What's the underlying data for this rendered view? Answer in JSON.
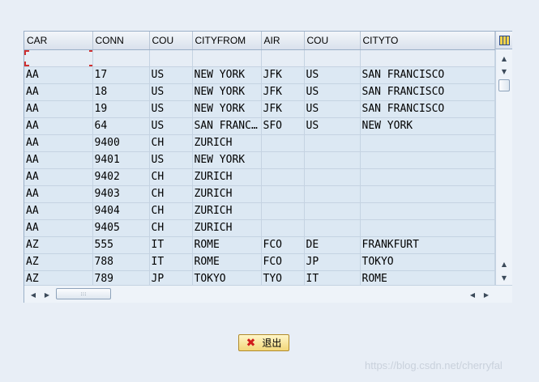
{
  "grid": {
    "columns": [
      "CAR",
      "CONN",
      "COU",
      "CITYFROM",
      "AIR",
      "COU",
      "CITYTO"
    ],
    "rows": [
      [
        "AA",
        "17",
        "US",
        "NEW YORK",
        "JFK",
        "US",
        "SAN FRANCISCO"
      ],
      [
        "AA",
        "18",
        "US",
        "NEW YORK",
        "JFK",
        "US",
        "SAN FRANCISCO"
      ],
      [
        "AA",
        "19",
        "US",
        "NEW YORK",
        "JFK",
        "US",
        "SAN FRANCISCO"
      ],
      [
        "AA",
        "64",
        "US",
        "SAN FRANC…",
        "SFO",
        "US",
        "NEW YORK"
      ],
      [
        "AA",
        "9400",
        "CH",
        "ZURICH",
        "",
        "",
        ""
      ],
      [
        "AA",
        "9401",
        "US",
        "NEW YORK",
        "",
        "",
        ""
      ],
      [
        "AA",
        "9402",
        "CH",
        "ZURICH",
        "",
        "",
        ""
      ],
      [
        "AA",
        "9403",
        "CH",
        "ZURICH",
        "",
        "",
        ""
      ],
      [
        "AA",
        "9404",
        "CH",
        "ZURICH",
        "",
        "",
        ""
      ],
      [
        "AA",
        "9405",
        "CH",
        "ZURICH",
        "",
        "",
        ""
      ],
      [
        "AZ",
        "555",
        "IT",
        "ROME",
        "FCO",
        "DE",
        "FRANKFURT"
      ],
      [
        "AZ",
        "788",
        "IT",
        "ROME",
        "FCO",
        "JP",
        "TOKYO"
      ],
      [
        "AZ",
        "789",
        "JP",
        "TOKYO",
        "TYO",
        "IT",
        "ROME"
      ]
    ]
  },
  "icons": {
    "layout": "layout-icon",
    "scroll_up": "▲",
    "scroll_down": "▼",
    "scroll_left": "◀",
    "scroll_right": "▶",
    "exit": "✖"
  },
  "footer": {
    "exit_label": "退出"
  },
  "watermark": "https://blog.csdn.net/cherryfal"
}
